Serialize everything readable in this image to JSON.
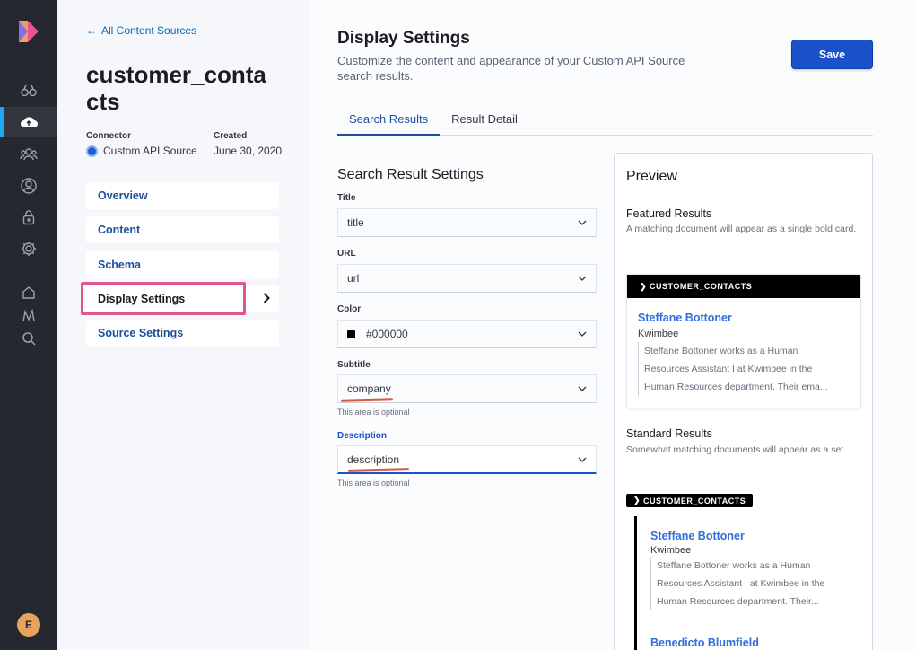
{
  "colors": {
    "rail": "#25282f",
    "accent": "#1a51c9",
    "link": "#1d4f9e",
    "highlight": "#e0578d",
    "annotation": "#d85840"
  },
  "rail": {
    "icons": [
      "binoculars-icon",
      "cloud-upload-icon",
      "users-icon",
      "user-circle-icon",
      "lock-icon",
      "gear-icon",
      "home-icon",
      "analytics-icon",
      "search-icon"
    ],
    "avatar_initial": "E"
  },
  "subnav": {
    "back_label": "All Content Sources",
    "source_title": "customer_contacts",
    "connector_label": "Connector",
    "connector_value": "Custom API Source",
    "created_label": "Created",
    "created_value": "June 30, 2020",
    "items": [
      {
        "label": "Overview"
      },
      {
        "label": "Content"
      },
      {
        "label": "Schema"
      },
      {
        "label": "Display Settings"
      },
      {
        "label": "Source Settings"
      }
    ]
  },
  "main": {
    "title": "Display Settings",
    "description": "Customize the content and appearance of your Custom API Source search results.",
    "save_label": "Save",
    "tabs": [
      {
        "label": "Search Results"
      },
      {
        "label": "Result Detail"
      }
    ],
    "form_title": "Search Result Settings",
    "fields": {
      "title": {
        "label": "Title",
        "value": "title"
      },
      "url": {
        "label": "URL",
        "value": "url"
      },
      "color": {
        "label": "Color",
        "value": "#000000",
        "swatch": "#000000"
      },
      "subtitle": {
        "label": "Subtitle",
        "value": "company",
        "help": "This area is optional"
      },
      "description": {
        "label": "Description",
        "value": "description",
        "help": "This area is optional"
      }
    }
  },
  "preview": {
    "title": "Preview",
    "featured_heading": "Featured Results",
    "featured_sub": "A matching document will appear as a single bold card.",
    "source_badge": "CUSTOMER_CONTACTS",
    "result": {
      "title": "Steffane Bottoner",
      "company": "Kwimbee",
      "desc_lines_featured": [
        "Steffane Bottoner works as a Human",
        "Resources Assistant I at Kwimbee in the",
        "Human Resources department. Their ema..."
      ],
      "desc_lines_standard": [
        "Steffane Bottoner works as a Human",
        "Resources Assistant I at Kwimbee in the",
        "Human Resources department. Their..."
      ]
    },
    "standard_heading": "Standard Results",
    "standard_sub": "Somewhat matching documents will appear as a set.",
    "next_result_title": "Benedicto Blumfield"
  }
}
